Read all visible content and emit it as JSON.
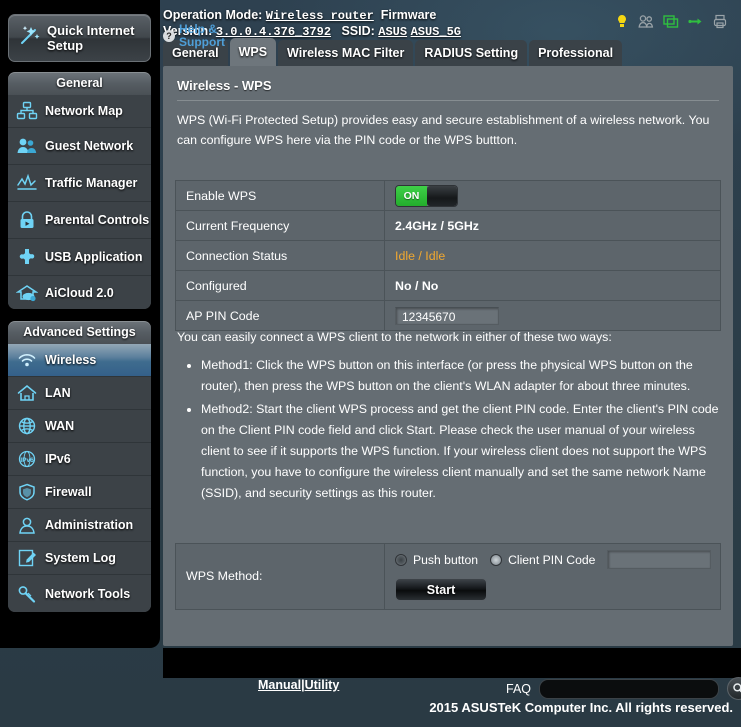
{
  "header": {
    "operation_mode_label": "Operation Mode:",
    "operation_mode_value": "Wireless router",
    "firmware_label": "Firmware",
    "version_label": "Version:",
    "version_value": "3.0.0.4.376_3792",
    "ssid_label": "SSID:",
    "ssid_value_1": "ASUS",
    "ssid_value_2": "ASUS_5G",
    "icons": [
      {
        "name": "notification-bulb-icon",
        "color": "#f5d712"
      },
      {
        "name": "clients-users-icon",
        "color": "#9aa3a8"
      },
      {
        "name": "monitor-icon",
        "color": "#2fbf3f"
      },
      {
        "name": "usb-icon",
        "color": "#2fbf3f"
      },
      {
        "name": "printer-icon",
        "color": "#9aa3a8"
      }
    ]
  },
  "sidebar": {
    "quick_setup": {
      "label": "Quick Internet Setup",
      "icon": "magic-wand-icon"
    },
    "groups": [
      {
        "title": "General",
        "items": [
          {
            "label": "Network Map",
            "icon": "network-map-icon",
            "active": false
          },
          {
            "label": "Guest Network",
            "icon": "guest-network-icon",
            "active": false
          },
          {
            "label": "Traffic Manager",
            "icon": "traffic-manager-icon",
            "active": false
          },
          {
            "label": "Parental Controls",
            "icon": "parental-controls-icon",
            "active": false
          },
          {
            "label": "USB Application",
            "icon": "usb-application-icon",
            "active": false
          },
          {
            "label": "AiCloud 2.0",
            "icon": "aicloud-icon",
            "active": false
          }
        ]
      },
      {
        "title": "Advanced Settings",
        "items": [
          {
            "label": "Wireless",
            "icon": "wireless-icon",
            "active": true
          },
          {
            "label": "LAN",
            "icon": "lan-home-icon",
            "active": false
          },
          {
            "label": "WAN",
            "icon": "wan-globe-icon",
            "active": false
          },
          {
            "label": "IPv6",
            "icon": "ipv6-icon",
            "active": false
          },
          {
            "label": "Firewall",
            "icon": "firewall-shield-icon",
            "active": false
          },
          {
            "label": "Administration",
            "icon": "administration-user-icon",
            "active": false
          },
          {
            "label": "System Log",
            "icon": "system-log-icon",
            "active": false
          },
          {
            "label": "Network Tools",
            "icon": "network-tools-icon",
            "active": false
          }
        ]
      }
    ]
  },
  "tabs": [
    {
      "label": "General",
      "active": false
    },
    {
      "label": "WPS",
      "active": true
    },
    {
      "label": "Wireless MAC Filter",
      "active": false
    },
    {
      "label": "RADIUS Setting",
      "active": false
    },
    {
      "label": "Professional",
      "active": false
    }
  ],
  "main": {
    "title": "Wireless - WPS",
    "intro": "WPS (Wi-Fi Protected Setup) provides easy and secure establishment of a wireless network. You can configure WPS here via the PIN code or the WPS buttton.",
    "settings": [
      {
        "key": "Enable WPS",
        "type": "toggle",
        "value": "ON",
        "state": "on"
      },
      {
        "key": "Current Frequency",
        "type": "text",
        "value": "2.4GHz / 5GHz"
      },
      {
        "key": "Connection Status",
        "type": "status",
        "value": "Idle / Idle"
      },
      {
        "key": "Configured",
        "type": "text",
        "value": "No / No"
      },
      {
        "key": "AP PIN Code",
        "type": "field",
        "value": "12345670"
      }
    ],
    "ways_intro": "You can easily connect a WPS client to the network in either of these two ways:",
    "methods": [
      "Method1: Click the WPS button on this interface (or press the physical WPS button on the router), then press the WPS button on the client's WLAN adapter for about three minutes.",
      "Method2: Start the client WPS process and get the client PIN code. Enter the client's PIN code on the Client PIN code field and click Start. Please check the user manual of your wireless client to see if it supports the WPS function. If your wireless client does not support the WPS function, you have to configure the wireless client manually and set the same network Name (SSID), and security settings as this router."
    ],
    "wps_method": {
      "label": "WPS Method:",
      "options": [
        {
          "label": "Push button",
          "selected": true
        },
        {
          "label": "Client PIN Code",
          "selected": false
        }
      ],
      "pin_value": "",
      "pin_placeholder": "",
      "start_label": "Start"
    }
  },
  "footer": {
    "help_label": "Help & Support",
    "help_icon": "question-mark-icon",
    "manual_label": "Manual",
    "manual_separator": "|",
    "utility_label": "Utility",
    "faq_label": "FAQ",
    "faq_value": "",
    "faq_placeholder": "",
    "search_icon": "magnifier-icon",
    "copyright": "2015 ASUSTeK Computer Inc. All rights reserved."
  },
  "colors": {
    "page_bg": "#2b3d48",
    "panel_bg": "#656d73",
    "row_bg": "#5d656b",
    "sidebar_bg": "#3c4247",
    "active_item": "#3f6c8e",
    "toggle_on": "#23ad2c",
    "status_idle": "#f0a830",
    "link_blue": "#4e9fd8",
    "icon_blue": "#5fc8f0"
  }
}
